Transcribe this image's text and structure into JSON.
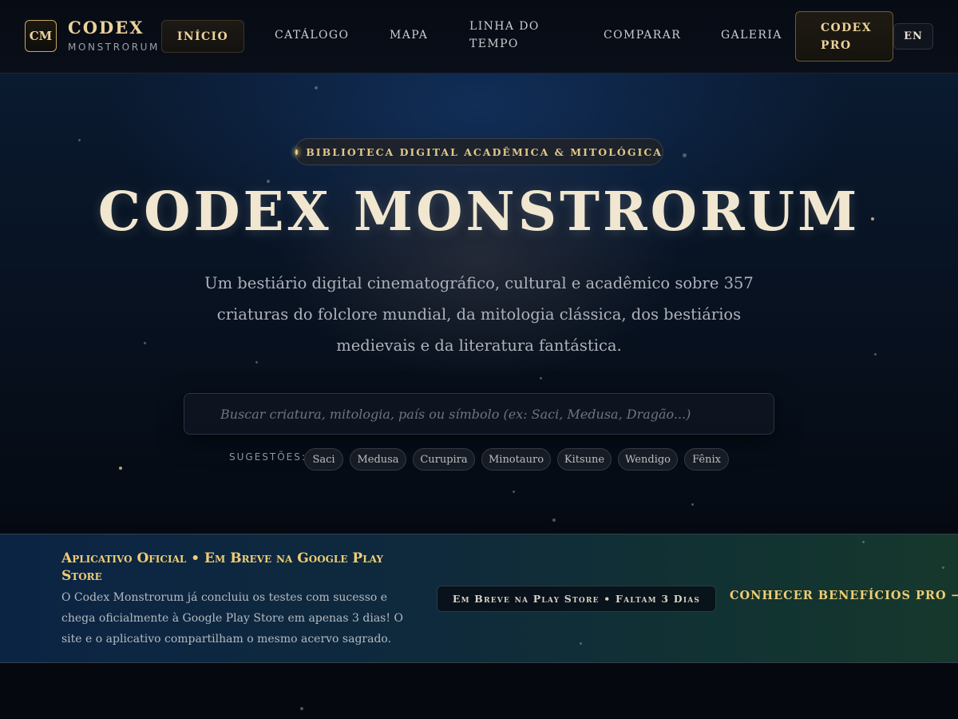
{
  "header": {
    "logo_mark": "CM",
    "brand_title": "CODEX",
    "brand_subtitle": "MONSTRORUM",
    "nav": {
      "home": "INÍCIO",
      "catalog": "CATÁLOGO",
      "map": "MAPA",
      "timeline": "LINHA DO TEMPO",
      "compare": "COMPARAR",
      "gallery": "GALERIA",
      "pro": "CODEX PRO"
    },
    "lang": "EN",
    "active_item": "INÍCIO"
  },
  "hero": {
    "badge": "BIBLIOTECA DIGITAL ACADÊMICA & MITOLÓGICA",
    "title": "CODEX MONSTRORUM",
    "description": "Um bestiário digital cinematográfico, cultural e acadêmico sobre 357 criaturas do folclore mundial, da mitologia clássica, dos bestiários medievais e da literatura fantástica.",
    "search": {
      "placeholder": "Buscar criatura, mitologia, país ou símbolo (ex: Saci, Medusa, Dragão...)",
      "value": ""
    },
    "suggestions_label": "SUGESTÕES:",
    "suggestions": [
      "Saci",
      "Medusa",
      "Curupira",
      "Minotauro",
      "Kitsune",
      "Wendigo",
      "Fênix"
    ]
  },
  "banner": {
    "title": "Aplicativo Oficial • Em Breve na Google Play Store",
    "text": "O Codex Monstrorum já concluiu os testes com sucesso e chega oficialmente à Google Play Store em apenas 3 dias! O site e o aplicativo compartilham o mesmo acervo sagrado.",
    "badge": "Em Breve na Play Store • Faltam 3 Dias",
    "link": "CONHECER BENEFÍCIOS PRO →"
  },
  "colors": {
    "accent_gold": "#f0cd74",
    "background": "#05080f",
    "hero_blue": "#0a1a30"
  }
}
